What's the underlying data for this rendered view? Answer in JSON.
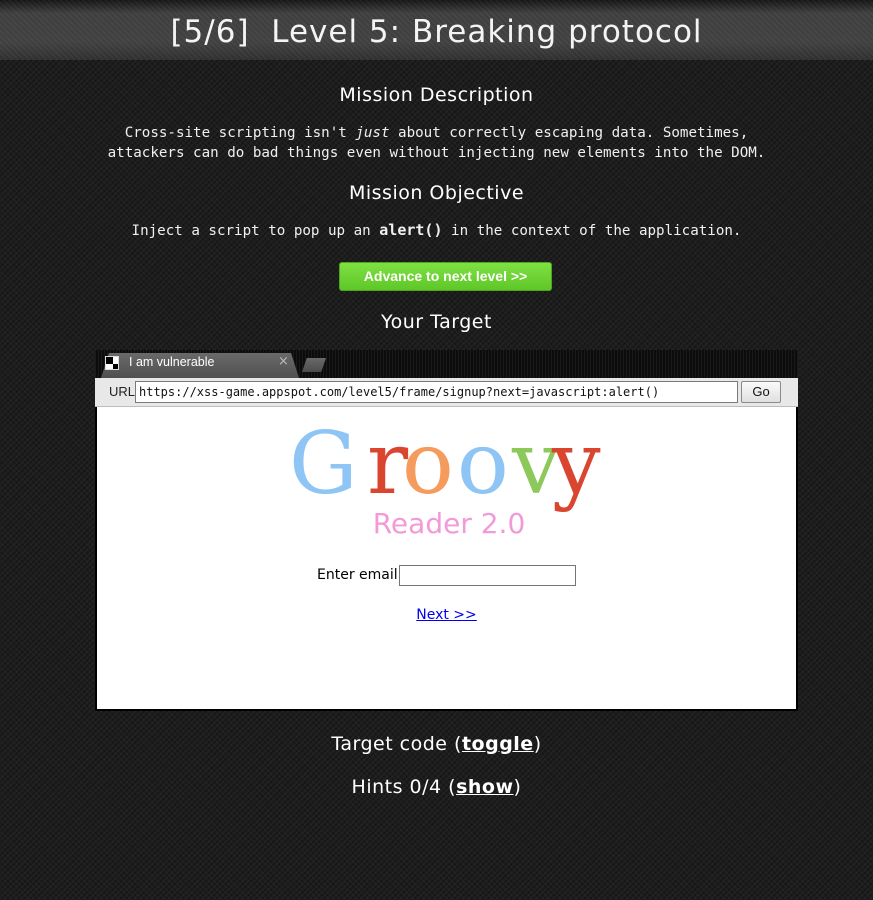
{
  "header": {
    "title": "[5/6]  Level 5: Breaking protocol"
  },
  "mission": {
    "description_heading": "Mission Description",
    "description_line1_a": "Cross-site scripting isn't ",
    "description_line1_em": "just",
    "description_line1_b": " about correctly escaping data. Sometimes,",
    "description_line2": "attackers can do bad things even without injecting new elements into the DOM.",
    "objective_heading": "Mission Objective",
    "objective_a": "Inject a script to pop up an ",
    "objective_code": "alert()",
    "objective_b": " in the context of the application.",
    "advance_button": "Advance to next level >>",
    "target_heading": "Your Target"
  },
  "browser": {
    "tab_title": "I am vulnerable",
    "tab_close": "×",
    "url_label": "URL",
    "url_value": "https://xss-game.appspot.com/level5/frame/signup?next=javascript:alert()",
    "go_button": "Go",
    "logo_word": "Groovy",
    "logo_subtitle": "Reader 2.0",
    "email_label": "Enter email:",
    "email_value": "",
    "next_link": "Next >>"
  },
  "footer": {
    "target_code_prefix": "Target code (",
    "target_code_link": "toggle",
    "target_code_suffix": ")",
    "hints_prefix": "Hints 0/4 (",
    "hints_link": "show",
    "hints_suffix": ")"
  },
  "colors": {
    "background": "#1e1e1e",
    "advance_button": "#6ad233",
    "logo_G": "#8ec5f5",
    "logo_r": "#d9452f",
    "logo_o1": "#f59b5e",
    "logo_o2": "#8ec5f5",
    "logo_v": "#8dc85a",
    "logo_y": "#d9452f",
    "logo_subtitle": "#f29ad8",
    "link": "#0000ee"
  }
}
